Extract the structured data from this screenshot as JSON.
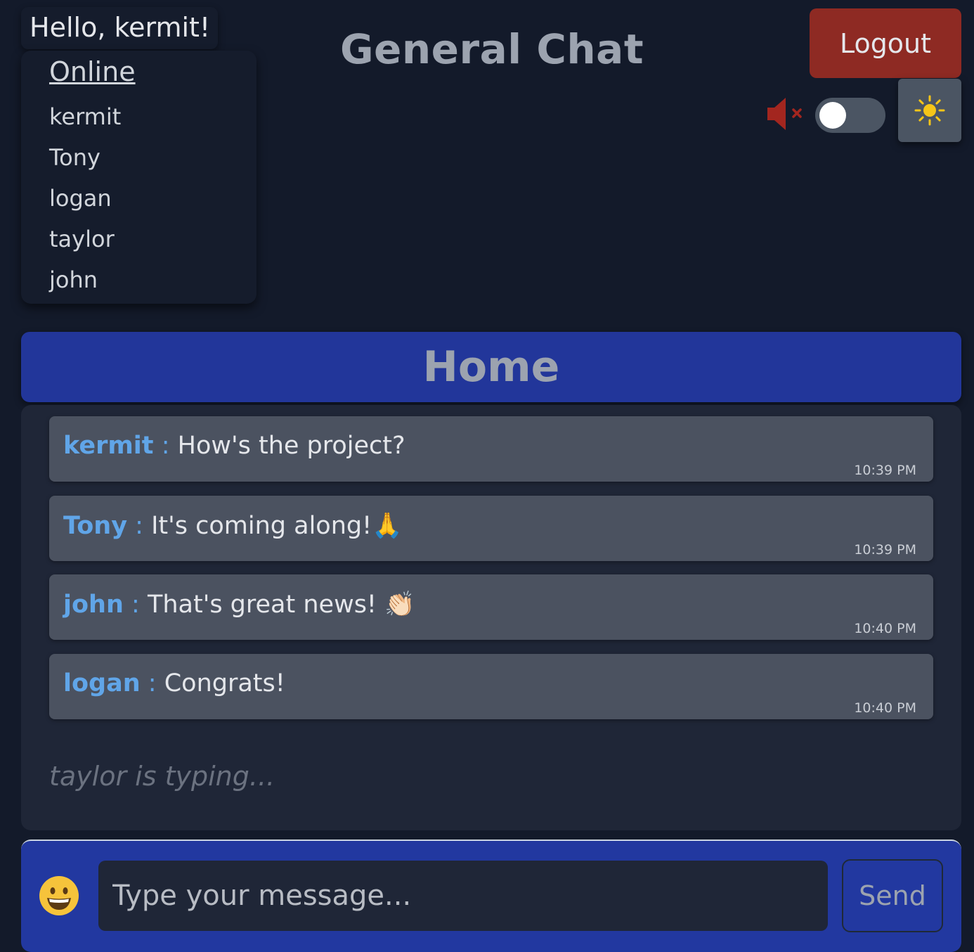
{
  "header": {
    "greeting": "Hello, kermit!",
    "app_title": "General Chat",
    "logout_label": "Logout"
  },
  "online": {
    "title": "Online",
    "users": [
      "kermit",
      "Tony",
      "logan",
      "taylor",
      "john"
    ]
  },
  "controls": {
    "mute_icon": "speaker-muted-icon",
    "sound_toggle_on": false,
    "theme_icon": "sun-icon"
  },
  "room": {
    "name": "Home"
  },
  "messages": [
    {
      "user": "kermit",
      "separator": ":",
      "text": "How's the project?",
      "time": "10:39 PM"
    },
    {
      "user": "Tony",
      "separator": ":",
      "text": "It's coming along!🙏",
      "time": "10:39 PM"
    },
    {
      "user": "john",
      "separator": ":",
      "text": "That's great news! 👏🏻",
      "time": "10:40 PM"
    },
    {
      "user": "logan",
      "separator": ":",
      "text": "Congrats!",
      "time": "10:40 PM"
    }
  ],
  "typing_indicator": "taylor is typing...",
  "composer": {
    "emoji_icon": "grinning-face-icon",
    "placeholder": "Type your message...",
    "value": "",
    "send_label": "Send"
  },
  "colors": {
    "background": "#131a2a",
    "accent_blue": "#22369a",
    "logout_red": "#8e2a23",
    "username_blue": "#60a5e8",
    "message_bg": "#4b5260"
  }
}
